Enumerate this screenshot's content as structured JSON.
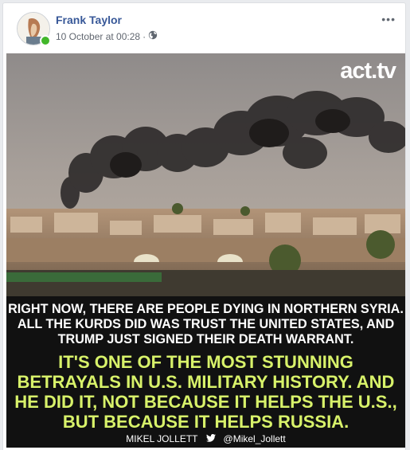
{
  "post": {
    "author_name": "Frank Taylor",
    "timestamp": "10 October at 00:28",
    "separator": "·",
    "audience_icon": "globe-icon",
    "more_label": "•••",
    "online": true
  },
  "image": {
    "logo": "act.tv",
    "caption_white": "RIGHT NOW, THERE ARE PEOPLE DYING IN NORTHERN SYRIA. ALL THE KURDS DID WAS TRUST THE UNITED STATES, AND TRUMP JUST SIGNED THEIR DEATH WARRANT.",
    "caption_green": "IT'S ONE OF THE MOST STUNNING BETRAYALS IN U.S. MILITARY HISTORY. AND HE DID IT, NOT BECAUSE IT HELPS THE U.S., BUT BECAUSE IT HELPS RUSSIA.",
    "credit_name": "MIKEL JOLLETT",
    "credit_handle": "@Mikel_Jollett",
    "credit_icon": "twitter-bird-icon"
  },
  "colors": {
    "link": "#385898",
    "online": "#42b72a",
    "caption_green": "#d8f26a"
  }
}
